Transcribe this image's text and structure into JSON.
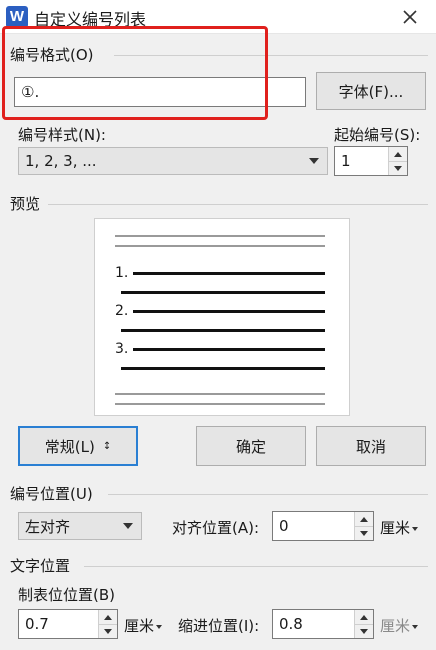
{
  "window": {
    "title": "自定义编号列表",
    "app_icon": "W"
  },
  "number_format": {
    "group_label": "编号格式(O)",
    "value": "①.",
    "font_button": "字体(F)..."
  },
  "number_style": {
    "label": "编号样式(N):",
    "selected": "1, 2, 3, ..."
  },
  "start_at": {
    "label": "起始编号(S):",
    "value": "1"
  },
  "preview": {
    "group_label": "预览",
    "numbers": [
      "1.",
      "2.",
      "3."
    ]
  },
  "buttons": {
    "normal": "常规(L)",
    "ok": "确定",
    "cancel": "取消"
  },
  "number_position": {
    "group_label": "编号位置(U)",
    "alignment": "左对齐",
    "aligned_at_label": "对齐位置(A):",
    "aligned_at_value": "0",
    "aligned_at_unit": "厘米"
  },
  "text_position": {
    "group_label": "文字位置",
    "tab_stop_label": "制表位位置(B)",
    "tab_stop_value": "0.7",
    "tab_stop_unit": "厘米",
    "indent_label": "缩进位置(I):",
    "indent_value": "0.8",
    "indent_unit": "厘米"
  },
  "colors": {
    "highlight": "#e0201d",
    "focus": "#2a7fd3",
    "app_icon_bg": "#2b5fc1"
  }
}
